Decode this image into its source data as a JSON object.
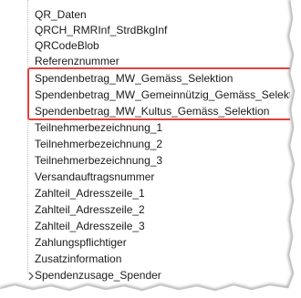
{
  "tree": {
    "items": [
      {
        "label": "QR_Daten"
      },
      {
        "label": "QRCH_RMRInf_StrdBkgInf"
      },
      {
        "label": "QRCodeBlob"
      },
      {
        "label": "Referenznummer"
      },
      {
        "label": "Spendenbetrag_MW_Gemäss_Selektion"
      },
      {
        "label": "Spendenbetrag_MW_Gemeinnützig_Gemäss_Selektion"
      },
      {
        "label": "Spendenbetrag_MW_Kultus_Gemäss_Selektion"
      },
      {
        "label": "Teilnehmerbezeichnung_1"
      },
      {
        "label": "Teilnehmerbezeichnung_2"
      },
      {
        "label": "Teilnehmerbezeichnung_3"
      },
      {
        "label": "Versandauftragsnummer"
      },
      {
        "label": "Zahlteil_Adresszeile_1"
      },
      {
        "label": "Zahlteil_Adresszeile_2"
      },
      {
        "label": "Zahlteil_Adresszeile_3"
      },
      {
        "label": "Zahlungspflichtiger"
      },
      {
        "label": "Zusatzinformation"
      },
      {
        "label": "Spendenzusage_Spender",
        "expandable": true
      }
    ]
  },
  "colors": {
    "highlight": "#e2403d",
    "text": "#1a1a1a"
  },
  "icons": {
    "expand": "chevron-right-icon"
  }
}
